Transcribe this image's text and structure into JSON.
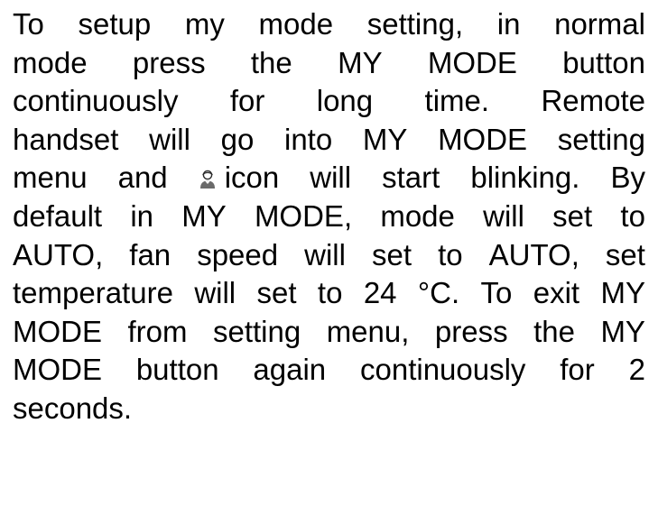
{
  "paragraph": {
    "lines": [
      [
        "To",
        "setup",
        "my",
        "mode",
        "setting,",
        "in",
        "normal"
      ],
      [
        "mode",
        "press",
        "the",
        "MY",
        "MODE",
        "button"
      ],
      [
        "continuously",
        "for",
        "long",
        "time.",
        "Remote"
      ],
      [
        "handset",
        "will",
        "go",
        "into",
        "MY",
        "MODE",
        "setting"
      ],
      [
        "menu",
        "and",
        "icon",
        "will",
        "start",
        "blinking.",
        "By"
      ],
      [
        "default",
        "in",
        "MY",
        "MODE,",
        "mode",
        "will",
        "set",
        "to"
      ],
      [
        "AUTO,",
        "fan",
        "speed",
        "will",
        "set",
        "to",
        "AUTO,",
        "set"
      ],
      [
        "temperature",
        "will",
        "set",
        "to",
        "24",
        "°C.",
        "To",
        "exit",
        "MY"
      ],
      [
        "MODE",
        "from",
        "setting",
        "menu,",
        "press",
        "the",
        "MY"
      ],
      [
        "MODE",
        "button",
        "again",
        "continuously",
        "for",
        "2"
      ],
      [
        "seconds."
      ]
    ],
    "icon_name": "my-mode-person-icon"
  }
}
